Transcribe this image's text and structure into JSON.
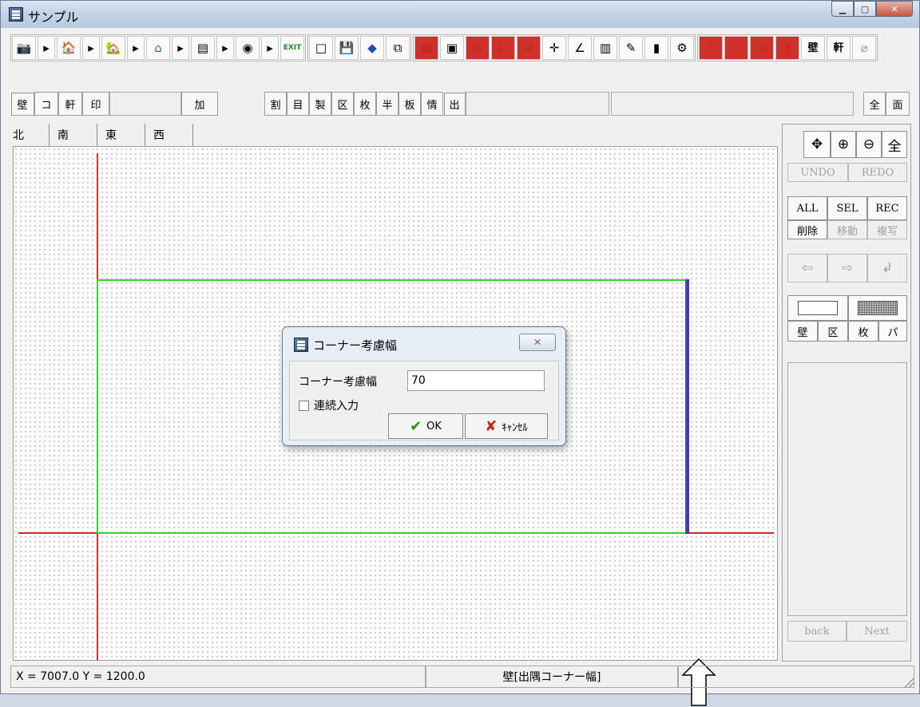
{
  "window": {
    "title": "サンプル"
  },
  "toolbar_text": {
    "left": [
      "壁",
      "コ",
      "軒",
      "印"
    ],
    "add": "加",
    "middle": [
      "割",
      "目",
      "製",
      "区",
      "枚",
      "半",
      "板",
      "情",
      "出"
    ],
    "right": [
      "全",
      "面"
    ]
  },
  "toolbar_icons": {
    "wall_label": "壁",
    "eave_label": "軒",
    "exit_label": "EXIT"
  },
  "tabs": [
    "北",
    "南",
    "東",
    "西"
  ],
  "right_panel": {
    "nav_icons": [
      "✥",
      "⊕",
      "⊖",
      "全"
    ],
    "undo": "UNDO",
    "redo": "REDO",
    "all": "ALL",
    "sel": "SEL",
    "rec": "REC",
    "delete": "削除",
    "move": "移動",
    "copy": "複写",
    "mode_buttons": [
      "壁",
      "区",
      "枚",
      "パ"
    ],
    "back": "back",
    "next": "Next"
  },
  "dialog": {
    "title": "コーナー考慮幅",
    "label": "コーナー考慮幅",
    "value": "70",
    "checkbox_label": "連続入力",
    "checkbox_checked": false,
    "ok": "OK",
    "cancel": "ｷｬﾝｾﾙ"
  },
  "status": {
    "coords": "X =  7007.0 Y =  1200.0",
    "mode": "壁[出隅コーナー幅]"
  }
}
